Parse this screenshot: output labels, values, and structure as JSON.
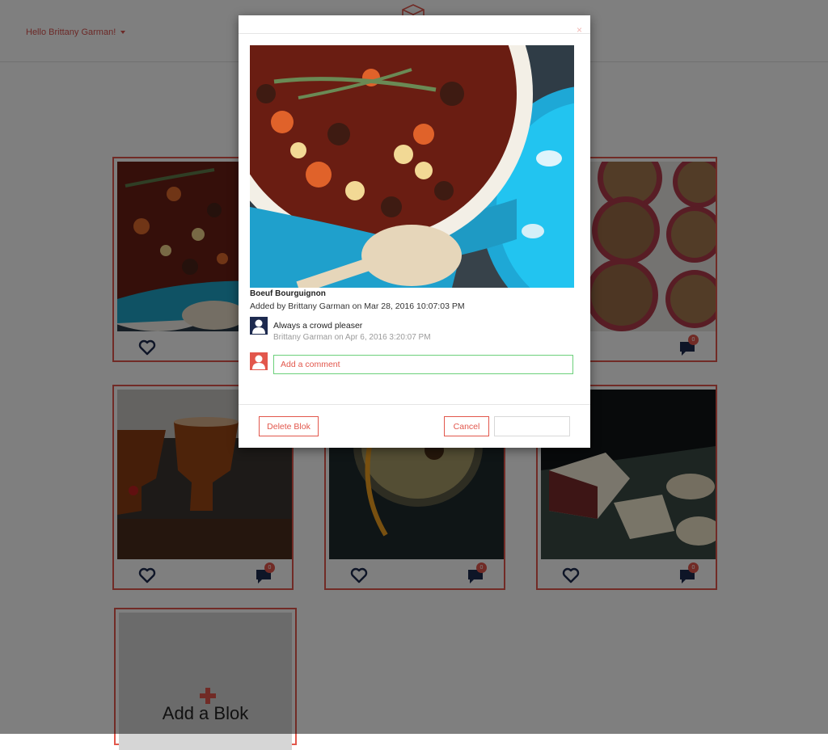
{
  "header": {
    "greeting": "Hello Brittany Garman!"
  },
  "grid": {
    "cards": [
      {
        "photo": "beef-stew-photo",
        "comment_count": "0"
      },
      {
        "photo": "crumble-tarts-photo",
        "comment_count": "0"
      },
      {
        "photo": "amber-cocktails-photo",
        "comment_count": "0"
      },
      {
        "photo": "citrus-cocktail-photo",
        "comment_count": "0"
      },
      {
        "photo": "cheese-crackers-photo",
        "comment_count": "0"
      }
    ],
    "add_label": "Add a Blok"
  },
  "modal": {
    "close_symbol": "×",
    "title": "Boeuf Bourguignon",
    "added_by": "Added by Brittany Garman on Mar 28, 2016 10:07:03 PM",
    "comments": [
      {
        "text": "Always a crowd pleaser",
        "meta": "Brittany Garman on Apr 6, 2016 3:20:07 PM"
      }
    ],
    "comment_placeholder": "Add a comment",
    "delete_label": "Delete Blok",
    "cancel_label": "Cancel",
    "save_label": ""
  },
  "colors": {
    "accent": "#e2574c",
    "avatar_dark": "#1d2a4f",
    "input_border": "#6cd07a",
    "backdrop": "rgba(0,0,0,0.5)"
  }
}
